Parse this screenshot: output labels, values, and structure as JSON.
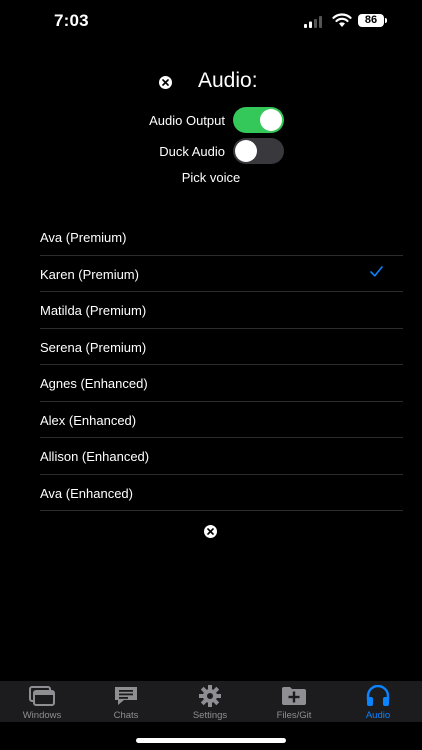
{
  "status": {
    "time": "7:03",
    "battery": "86"
  },
  "header": {
    "title": "Audio:"
  },
  "toggles": [
    {
      "label": "Audio Output",
      "on": true
    },
    {
      "label": "Duck Audio",
      "on": false
    }
  ],
  "pick_voice_label": "Pick voice",
  "voices": [
    {
      "label": "Ava (Premium)",
      "selected": false
    },
    {
      "label": "Karen (Premium)",
      "selected": true
    },
    {
      "label": "Matilda (Premium)",
      "selected": false
    },
    {
      "label": "Serena (Premium)",
      "selected": false
    },
    {
      "label": "Agnes (Enhanced)",
      "selected": false
    },
    {
      "label": "Alex (Enhanced)",
      "selected": false
    },
    {
      "label": "Allison (Enhanced)",
      "selected": false
    },
    {
      "label": "Ava (Enhanced)",
      "selected": false
    }
  ],
  "tabs": [
    {
      "label": "Windows",
      "icon": "windows-icon",
      "active": false
    },
    {
      "label": "Chats",
      "icon": "chat-bubble-icon",
      "active": false
    },
    {
      "label": "Settings",
      "icon": "gear-icon",
      "active": false
    },
    {
      "label": "Files/Git",
      "icon": "folder-plus-icon",
      "active": false
    },
    {
      "label": "Audio",
      "icon": "headphones-icon",
      "active": true
    }
  ],
  "colors": {
    "accent": "#0a84ff",
    "toggle_on": "#34c759",
    "toggle_off": "#39393d"
  }
}
